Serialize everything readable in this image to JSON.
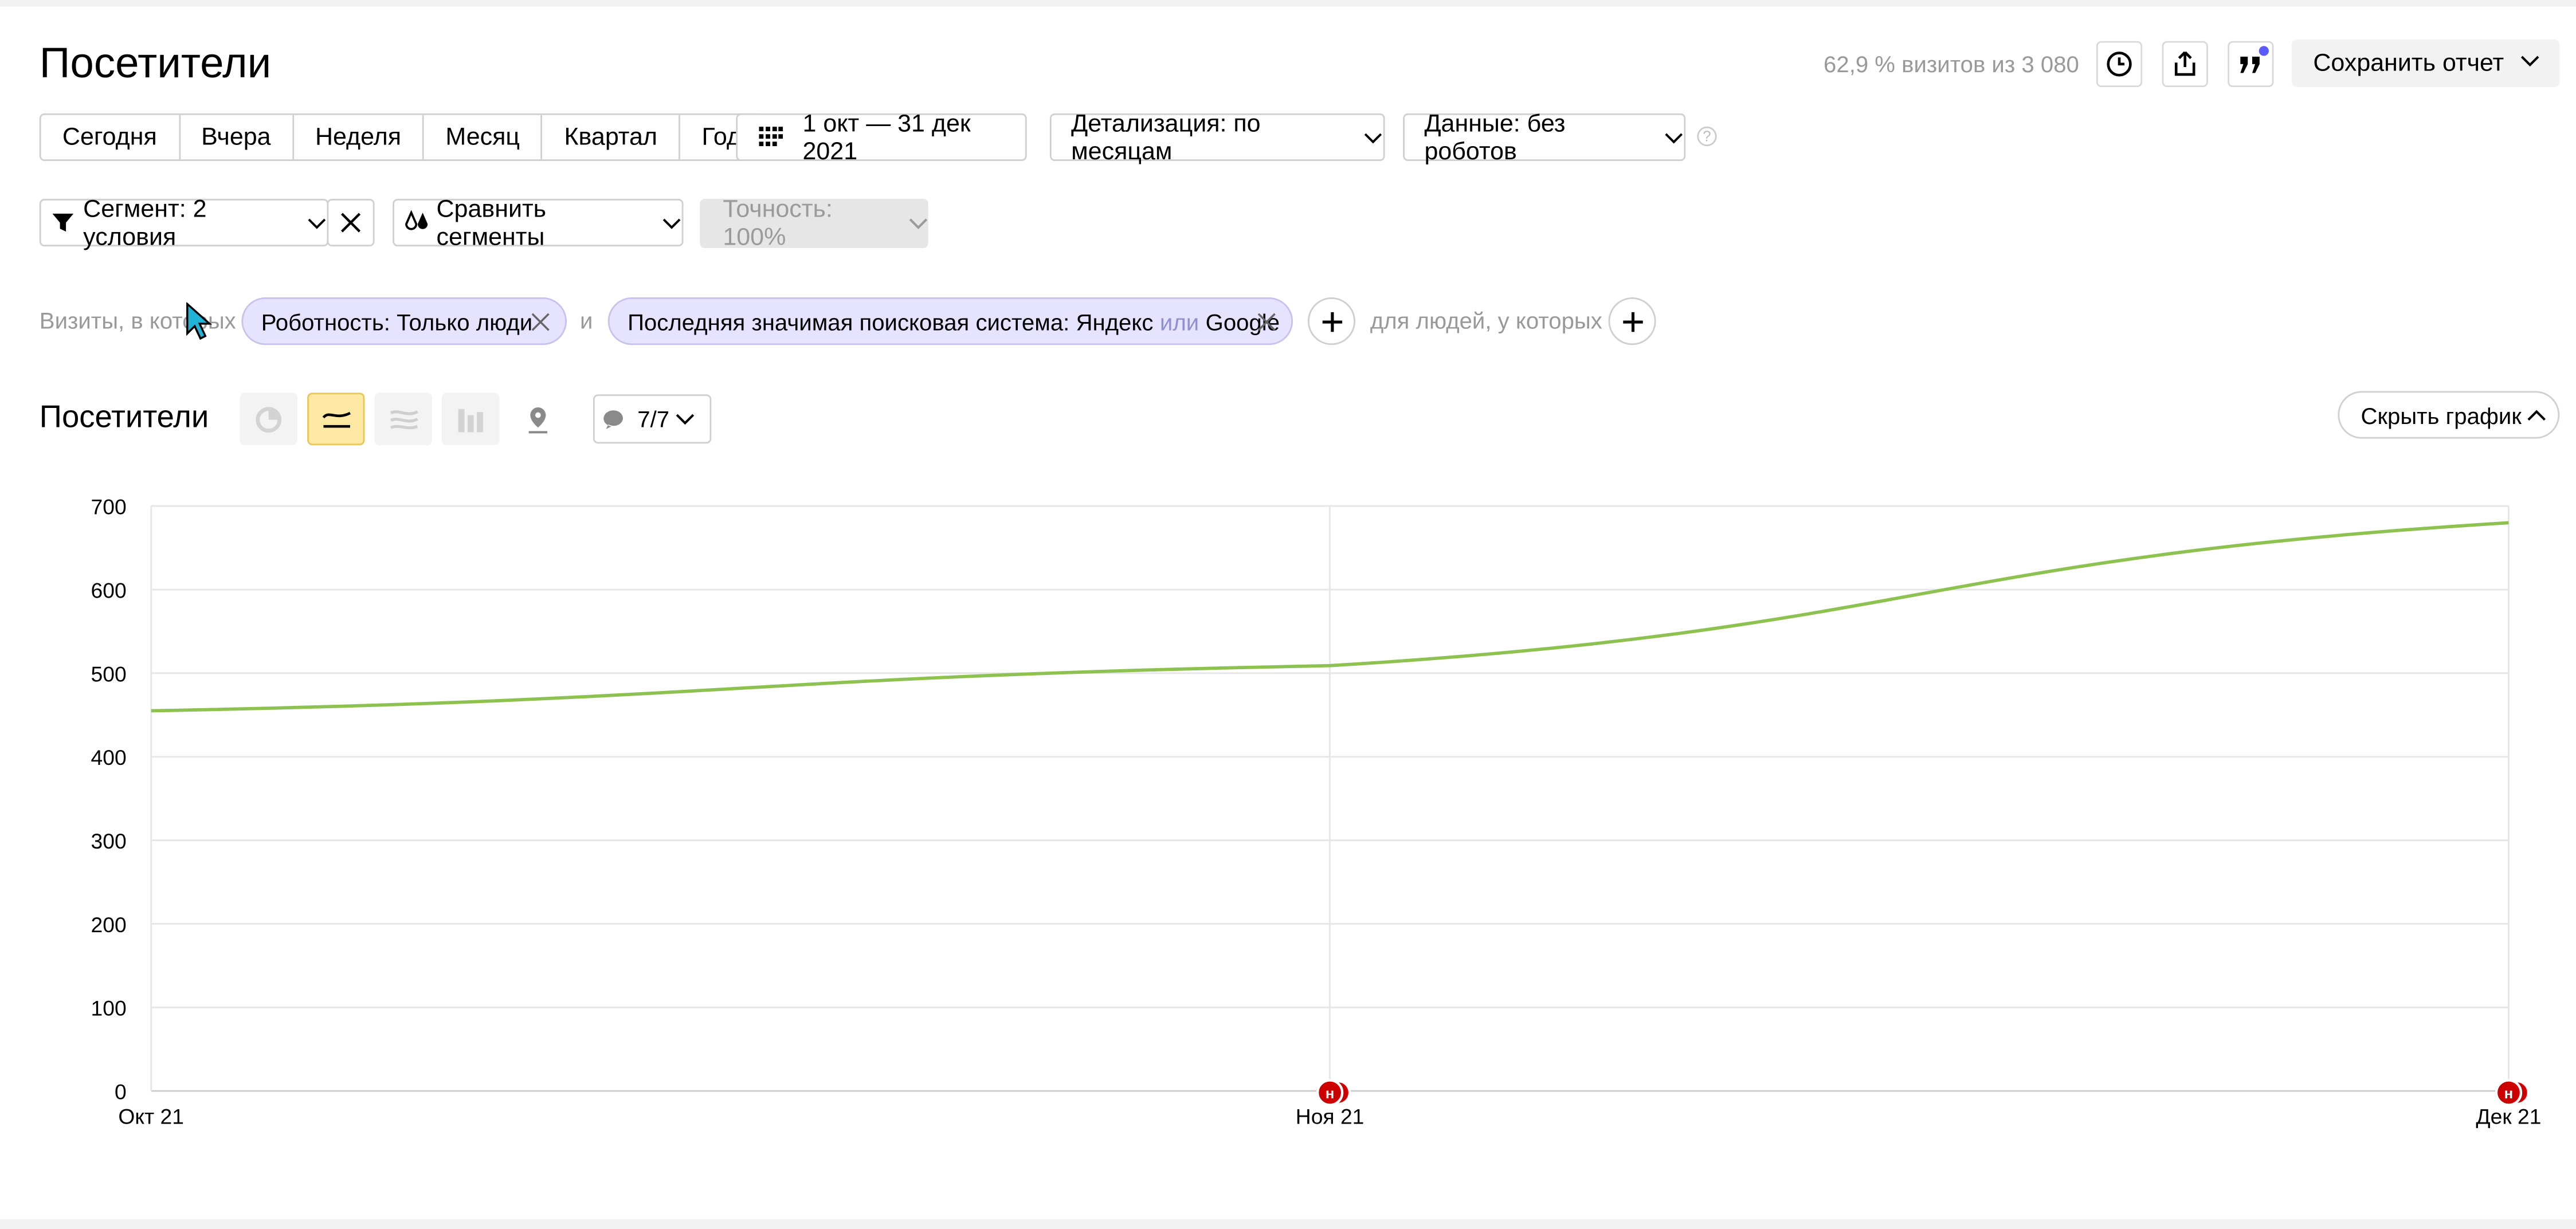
{
  "header": {
    "title": "Посетители",
    "visits_info": "62,9 % визитов из 3 080",
    "save_label": "Сохранить отчет"
  },
  "periods": [
    "Сегодня",
    "Вчера",
    "Неделя",
    "Месяц",
    "Квартал",
    "Год"
  ],
  "date_range": "1 окт — 31 дек 2021",
  "detail_label": "Детализация: по месяцам",
  "data_label": "Данные: без роботов",
  "help_mark": "?",
  "segment": {
    "label": "Сегмент: 2 условия",
    "compare_label": "Сравнить сегменты",
    "accuracy_label": "Точность: 100%"
  },
  "filters": {
    "prefix": "Визиты, в которых",
    "chip1": "Роботность: Только люди",
    "conj": "и",
    "chip2_part1": "Последняя значимая поисковая система: Яндекс",
    "chip2_or": "или",
    "chip2_part2": "Google",
    "people_label": "для людей, у которых"
  },
  "chart_section": {
    "title": "Посетители",
    "notes_label": "7/7",
    "hide_label": "Скрыть график"
  },
  "chart_data": {
    "type": "line",
    "x": [
      "Окт 21",
      "Ноя 21",
      "Дек 21"
    ],
    "series": [
      {
        "values": [
          455,
          509,
          680
        ],
        "color": "#8dc251"
      }
    ],
    "yticks": [
      0,
      100,
      200,
      300,
      400,
      500,
      600,
      700
    ],
    "ylim": [
      0,
      700
    ],
    "grid": true,
    "markers": [
      {
        "x": "Ноя 21",
        "label": "н",
        "color": "#cc0000"
      },
      {
        "x": "Дек 21",
        "label": "н",
        "color": "#cc0000"
      }
    ]
  }
}
